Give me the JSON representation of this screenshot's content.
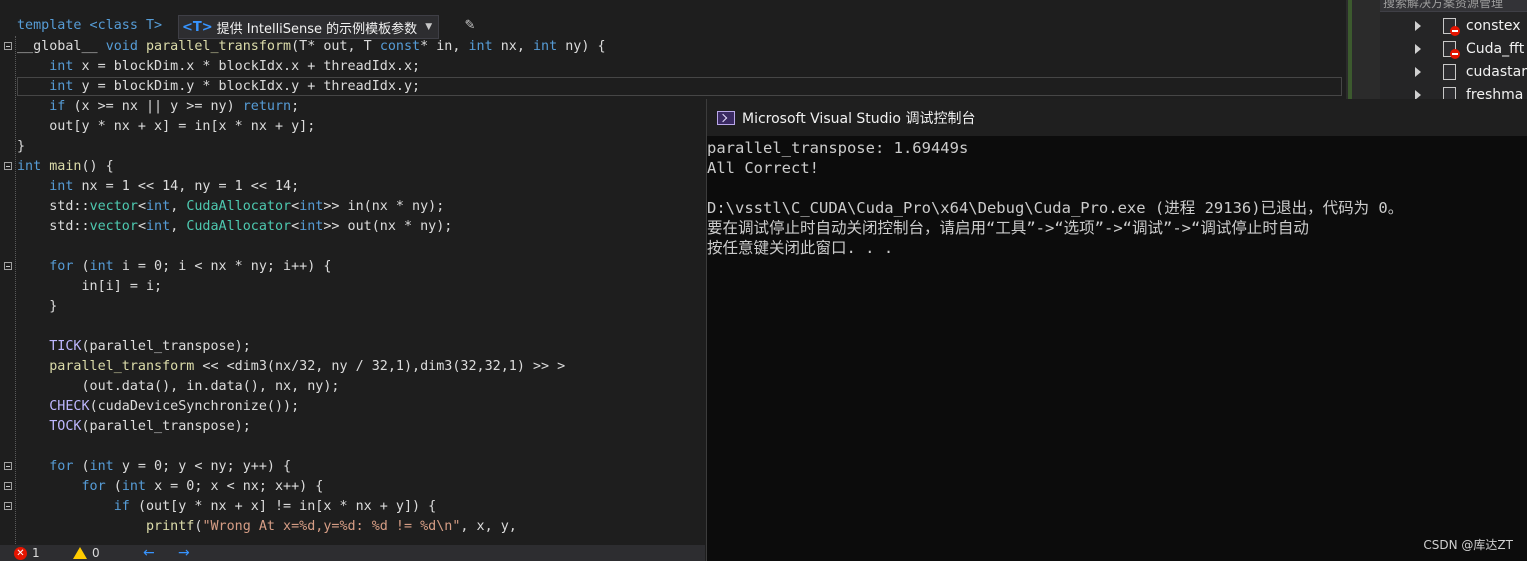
{
  "editor": {
    "template_prefix": "template <class T>",
    "template_chip_badge": "<T>",
    "template_chip_label": "提供 IntelliSense 的示例模板参数",
    "lines": [
      {
        "parts": [
          [
            "__global__ ",
            ""
          ],
          [
            "void ",
            "kw"
          ],
          [
            "parallel_transform",
            "fn"
          ],
          [
            "(T* out, T ",
            ""
          ],
          [
            "const",
            "kw"
          ],
          [
            "* in, ",
            ""
          ],
          [
            "int ",
            "kw"
          ],
          [
            "nx, ",
            ""
          ],
          [
            "int ",
            "kw"
          ],
          [
            "ny) {",
            ""
          ]
        ]
      },
      {
        "parts": [
          [
            "    ",
            ""
          ],
          [
            "int ",
            "kw"
          ],
          [
            "x = blockDim.x * blockIdx.x + threadIdx.x;",
            ""
          ]
        ]
      },
      {
        "parts": [
          [
            "    ",
            ""
          ],
          [
            "int ",
            "kw"
          ],
          [
            "y = blockDim.y * blockIdx.y + threadIdx.y;",
            ""
          ]
        ]
      },
      {
        "parts": [
          [
            "    ",
            ""
          ],
          [
            "if ",
            "kw"
          ],
          [
            "(x >= nx || y >= ny) ",
            ""
          ],
          [
            "return",
            "kw"
          ],
          [
            ";",
            ""
          ]
        ]
      },
      {
        "parts": [
          [
            "    out[y * nx + x] = in[x * nx + y];",
            ""
          ]
        ]
      },
      {
        "parts": [
          [
            "}",
            ""
          ]
        ]
      },
      {
        "parts": [
          [
            "int ",
            "kw"
          ],
          [
            "main",
            "fn"
          ],
          [
            "() {",
            ""
          ]
        ]
      },
      {
        "parts": [
          [
            "    ",
            ""
          ],
          [
            "int ",
            "kw"
          ],
          [
            "nx = 1 << 14, ny = 1 << 14;",
            ""
          ]
        ]
      },
      {
        "parts": [
          [
            "    std::",
            ""
          ],
          [
            "vector",
            "ty"
          ],
          [
            "<",
            ""
          ],
          [
            "int",
            "kw"
          ],
          [
            ", ",
            ""
          ],
          [
            "CudaAllocator",
            "ty"
          ],
          [
            "<",
            ""
          ],
          [
            "int",
            "kw"
          ],
          [
            ">> in(nx * ny);",
            ""
          ]
        ]
      },
      {
        "parts": [
          [
            "    std::",
            ""
          ],
          [
            "vector",
            "ty"
          ],
          [
            "<",
            ""
          ],
          [
            "int",
            "kw"
          ],
          [
            ", ",
            ""
          ],
          [
            "CudaAllocator",
            "ty"
          ],
          [
            "<",
            ""
          ],
          [
            "int",
            "kw"
          ],
          [
            ">> out(nx * ny);",
            ""
          ]
        ]
      },
      {
        "parts": [
          [
            "",
            ""
          ]
        ]
      },
      {
        "parts": [
          [
            "    ",
            ""
          ],
          [
            "for ",
            "kw"
          ],
          [
            "(",
            ""
          ],
          [
            "int ",
            "kw"
          ],
          [
            "i = 0; i < nx * ny; i++) {",
            ""
          ]
        ]
      },
      {
        "parts": [
          [
            "        in[i] = i;",
            ""
          ]
        ]
      },
      {
        "parts": [
          [
            "    }",
            ""
          ]
        ]
      },
      {
        "parts": [
          [
            "",
            ""
          ]
        ]
      },
      {
        "parts": [
          [
            "    ",
            ""
          ],
          [
            "TICK",
            "mac"
          ],
          [
            "(parallel_transpose);",
            ""
          ]
        ]
      },
      {
        "parts": [
          [
            "    ",
            ""
          ],
          [
            "parallel_transform",
            "fn"
          ],
          [
            " << <dim3(nx/32, ny / 32,1),dim3(32,32,1) >> >",
            ""
          ]
        ]
      },
      {
        "parts": [
          [
            "        (out.data(), in.data(), nx, ny);",
            ""
          ]
        ]
      },
      {
        "parts": [
          [
            "    ",
            ""
          ],
          [
            "CHECK",
            "mac"
          ],
          [
            "(cudaDeviceSynchronize());",
            ""
          ]
        ]
      },
      {
        "parts": [
          [
            "    ",
            ""
          ],
          [
            "TOCK",
            "mac"
          ],
          [
            "(parallel_transpose);",
            ""
          ]
        ]
      },
      {
        "parts": [
          [
            "",
            ""
          ]
        ]
      },
      {
        "parts": [
          [
            "    ",
            ""
          ],
          [
            "for ",
            "kw"
          ],
          [
            "(",
            ""
          ],
          [
            "int ",
            "kw"
          ],
          [
            "y = 0; y < ny; y++) {",
            ""
          ]
        ]
      },
      {
        "parts": [
          [
            "        ",
            ""
          ],
          [
            "for ",
            "kw"
          ],
          [
            "(",
            ""
          ],
          [
            "int ",
            "kw"
          ],
          [
            "x = 0; x < nx; x++) {",
            ""
          ]
        ]
      },
      {
        "parts": [
          [
            "            ",
            ""
          ],
          [
            "if ",
            "kw"
          ],
          [
            "(out[y * nx + x] != in[x * nx + y]) {",
            ""
          ]
        ]
      },
      {
        "parts": [
          [
            "                ",
            ""
          ],
          [
            "printf",
            "fn"
          ],
          [
            "(",
            ""
          ],
          [
            "\"Wrong At x=%d,y=%d: %d != %d\\n\"",
            "str"
          ],
          [
            ", x, y,",
            ""
          ]
        ]
      }
    ],
    "folds": [
      0,
      6,
      11,
      21,
      22,
      23
    ]
  },
  "status": {
    "errors": "1",
    "warnings": "0",
    "back_icon": "arrow-left-icon",
    "forward_icon": "arrow-right-icon"
  },
  "solution": {
    "search_placeholder": "搜索解决方案资源管理",
    "items": [
      {
        "label": "constex",
        "icon": "file-error-icon"
      },
      {
        "label": "Cuda_fft",
        "icon": "file-error-icon"
      },
      {
        "label": "cudastar",
        "icon": "file-icon"
      },
      {
        "label": "freshma",
        "icon": "file-icon"
      }
    ]
  },
  "console": {
    "title": "Microsoft Visual Studio 调试控制台",
    "lines": [
      "parallel_transpose: 1.69449s",
      "All Correct!",
      "",
      "D:\\vsstl\\C_CUDA\\Cuda_Pro\\x64\\Debug\\Cuda_Pro.exe (进程 29136)已退出，代码为 0。",
      "要在调试停止时自动关闭控制台，请启用“工具”->“选项”->“调试”->“调试停止时自动",
      "按任意键关闭此窗口. . ."
    ]
  },
  "watermark": "CSDN @库达ZT",
  "colors": {
    "editor_bg": "#1e1e1e",
    "console_bg": "#0c0c0c",
    "keyword": "#569cd6",
    "function": "#dcdcaa",
    "type": "#4ec9b0",
    "macro": "#beb7ff",
    "string": "#d69d85",
    "error": "#e51400",
    "warning": "#ffcc00"
  }
}
